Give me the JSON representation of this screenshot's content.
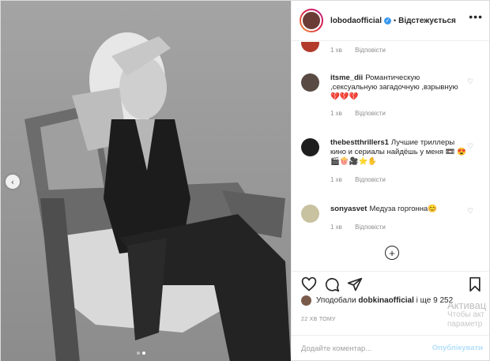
{
  "header": {
    "username": "lobodaofficial",
    "separator": "•",
    "follow_status": "Відстежується",
    "more_label": "•••"
  },
  "photo": {
    "carousel_dots": 2,
    "active_dot": 1,
    "prev_icon": "chevron-left-icon"
  },
  "comments": [
    {
      "username": "",
      "text": "",
      "time": "1 хв",
      "reply": "Відповісти",
      "avatar_color": "#b23a2a"
    },
    {
      "username": "itsme_dii",
      "text": "Романтическую ,сексуальную загадочную ,взрывную💔💔💔",
      "time": "1 хв",
      "reply": "Відповісти",
      "avatar_color": "#5a4a44"
    },
    {
      "username": "thebestthrillers1",
      "text": "Лучшие триллеры кино и сериалы найдёшь у меня 📼 😍🎬🍿🎥⭐✋",
      "time": "1 хв",
      "reply": "Відповісти",
      "avatar_color": "#1e1e1e"
    },
    {
      "username": "sonyasvet",
      "text": "Медуза горгонна😊",
      "time": "1 хв",
      "reply": "Відповісти",
      "avatar_color": "#c9c2a0"
    }
  ],
  "actions": {
    "like_icon": "heart-icon",
    "comment_icon": "comment-icon",
    "share_icon": "send-icon",
    "save_icon": "bookmark-icon"
  },
  "likes": {
    "prefix": "Уподобали",
    "user": "dobkinaofficial",
    "suffix": "і ще 9 252"
  },
  "time_ago": "22 ХВ ТОМУ",
  "composer": {
    "placeholder": "Додайте коментар...",
    "publish_label": "Опублікувати"
  },
  "overlay": {
    "line1": "Активац",
    "line2": "Чтобы акт",
    "line3": "параметр"
  }
}
